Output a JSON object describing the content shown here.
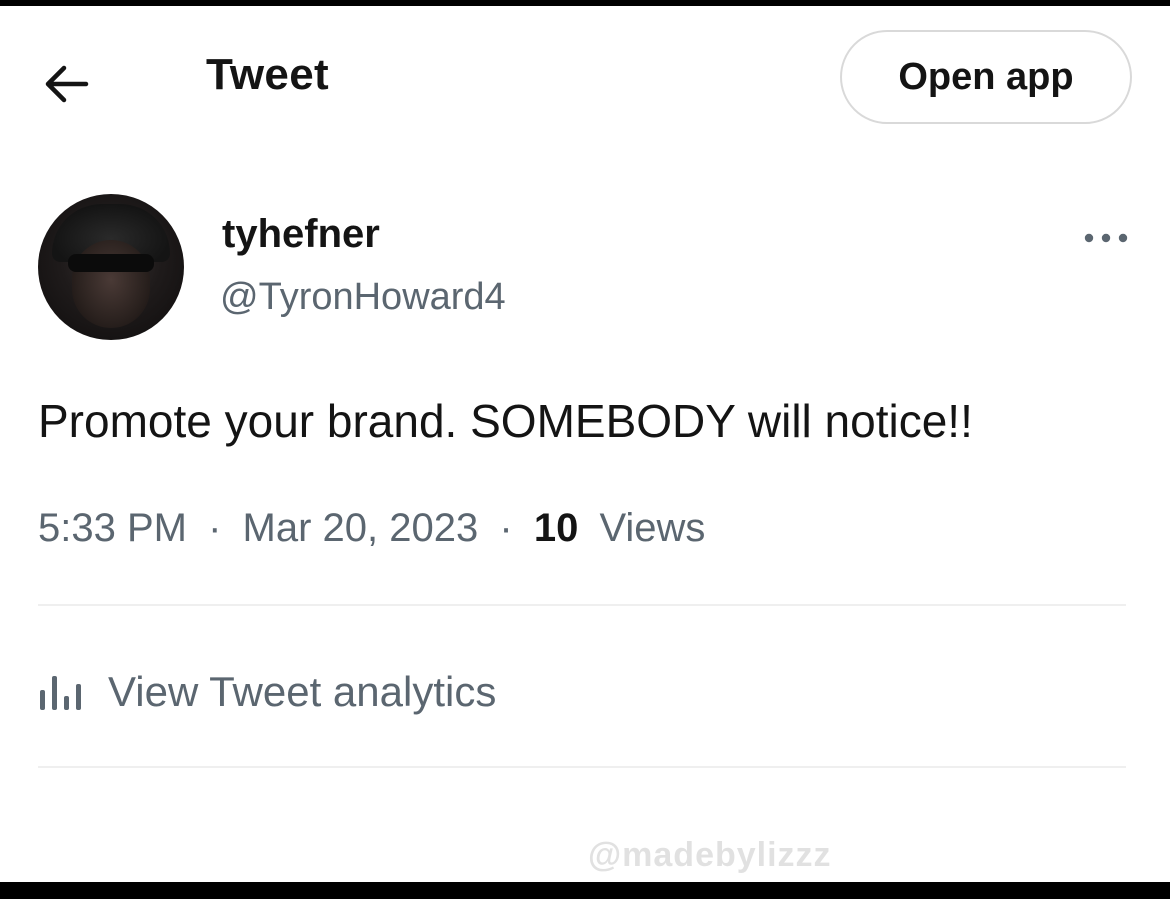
{
  "header": {
    "title": "Tweet",
    "open_app_label": "Open app",
    "back_icon": "arrow-left-icon"
  },
  "author": {
    "display_name": "tyhefner",
    "handle": "@TyronHoward4",
    "more_icon": "more-horizontal-icon"
  },
  "tweet": {
    "text": "Promote your brand. SOMEBODY will notice!!",
    "time": "5:33 PM",
    "date": "Mar 20, 2023",
    "views_count": "10",
    "views_label": "Views",
    "separator": "·"
  },
  "analytics": {
    "label": "View Tweet analytics",
    "icon": "bar-chart-icon"
  },
  "watermark": {
    "text": "@madebylizzz"
  },
  "colors": {
    "text_primary": "#141414",
    "text_secondary": "#5b6670",
    "divider": "#efefef",
    "button_border": "#d9d9d9"
  }
}
